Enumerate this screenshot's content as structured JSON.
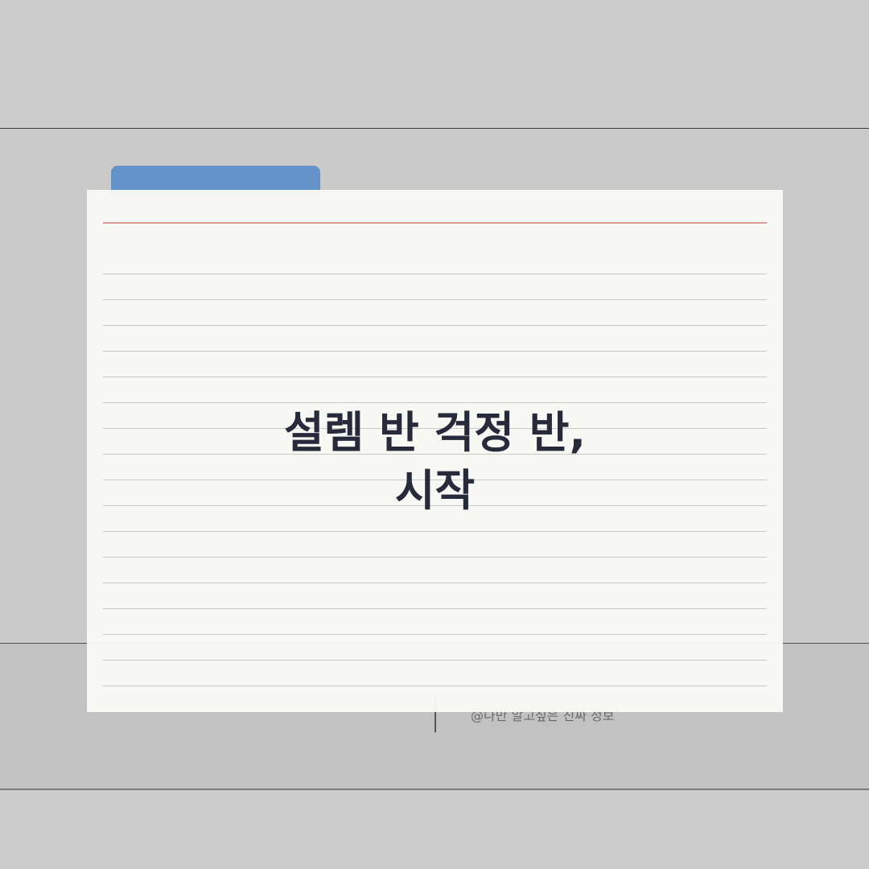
{
  "card": {
    "title_line_1": "설렘 반 걱정 반,",
    "title_line_2": "시작"
  },
  "footer": {
    "caption": "@나만 알고싶은 진짜 정보"
  },
  "colors": {
    "background": "#cbcbcb",
    "folder_tab": "#6493c9",
    "card": "#f9f9f5",
    "margin_line": "#d99a9a",
    "title_text": "#262a3a"
  }
}
